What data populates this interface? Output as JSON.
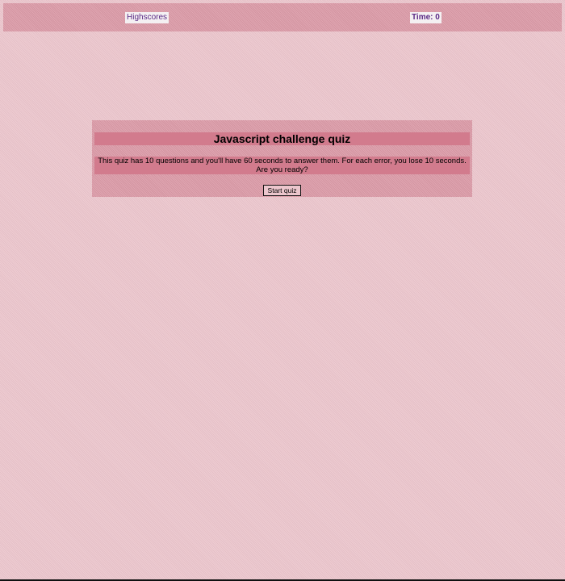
{
  "header": {
    "highscores_label": "Highscores",
    "timer_label": "Time: 0"
  },
  "quiz": {
    "title": "Javascript challenge quiz",
    "intro": "This quiz has 10 questions and you'll have 60 seconds to answer them. For each error, you lose 10 seconds. Are you ready?",
    "start_label": "Start quiz"
  },
  "colors": {
    "page_background": "#ecc6cd",
    "panel_background": "#dc9ba8",
    "heading_band": "#d27b8d",
    "link_text": "#5b2a86"
  }
}
